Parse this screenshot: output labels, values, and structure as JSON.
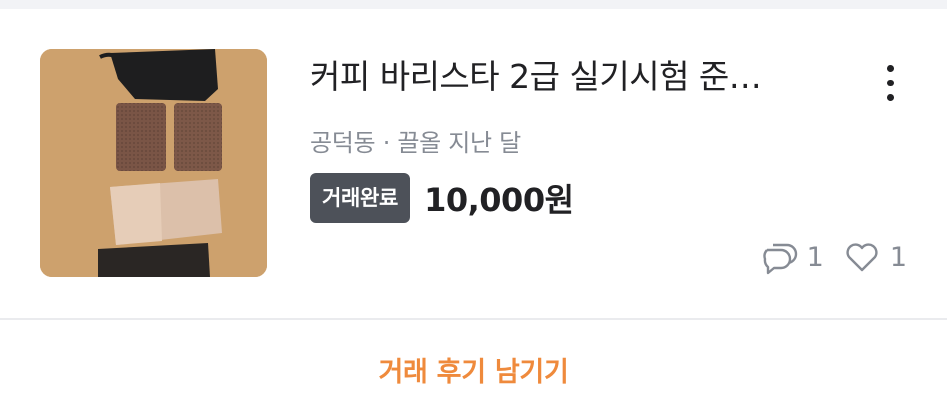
{
  "item": {
    "title": "커피 바리스타 2급 실기시험 준…",
    "location": "공덕동",
    "separator": "·",
    "time": "끌올 지난 달",
    "status_badge": "거래완료",
    "price": "10,000원",
    "chat_count": "1",
    "like_count": "1",
    "thumbnail_icon": "product-photo",
    "more_icon": "vertical-ellipsis-icon"
  },
  "actions": {
    "review_label": "거래 후기 남기기"
  },
  "colors": {
    "accent": "#ef8a3c",
    "badge_bg": "#4d5159",
    "text": "#212124",
    "muted": "#868b94"
  }
}
